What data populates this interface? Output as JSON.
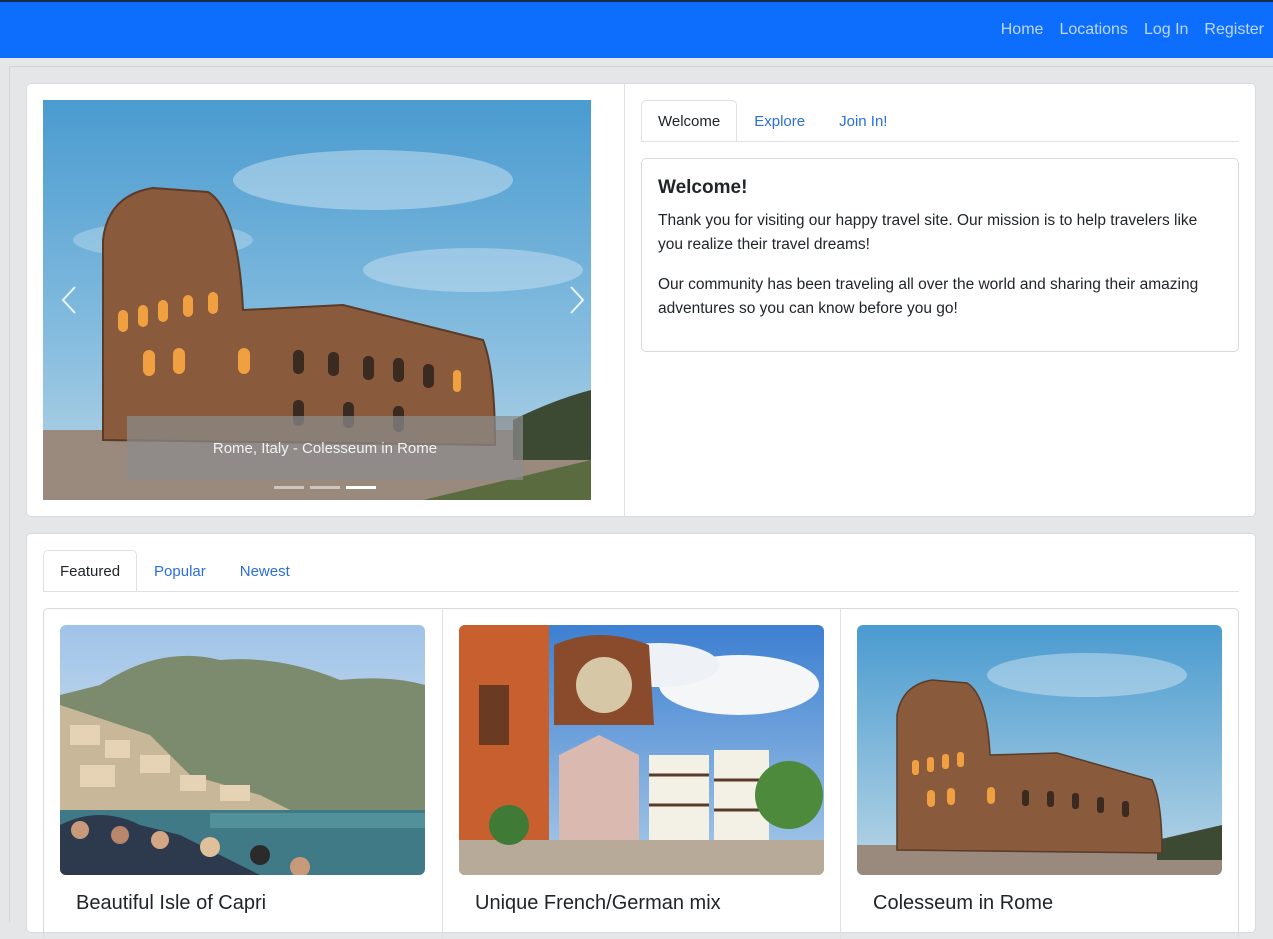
{
  "nav": {
    "links": [
      "Home",
      "Locations",
      "Log In",
      "Register"
    ],
    "bg_color": "#0d6efd"
  },
  "carousel": {
    "caption": "Rome, Italy - Colesseum in Rome",
    "slide_count": 3,
    "active_slide": 3,
    "prev_icon": "chevron-left-icon",
    "next_icon": "chevron-right-icon"
  },
  "welcome_tabs": [
    "Welcome",
    "Explore",
    "Join In!"
  ],
  "welcome": {
    "title": "Welcome!",
    "p1": "Thank you for visiting our happy travel site. Our mission is to help travelers like you realize their travel dreams!",
    "p2": "Our community has been traveling all over the world and sharing their amazing adventures so you can know before you go!"
  },
  "featured_tabs": [
    "Featured",
    "Popular",
    "Newest"
  ],
  "featured": [
    {
      "title": "Beautiful Isle of Capri"
    },
    {
      "title": "Unique French/German mix"
    },
    {
      "title": "Colesseum in Rome"
    }
  ],
  "colors": {
    "link": "#2a6fdc",
    "page_bg": "#e5e6e7"
  }
}
